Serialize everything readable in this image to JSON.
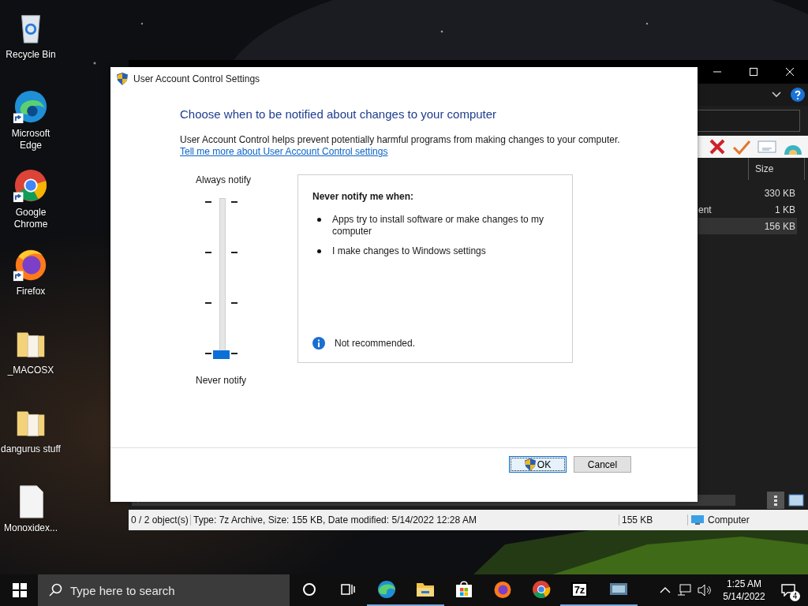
{
  "desktop_icons": [
    {
      "label": "Recycle Bin",
      "kind": "recycle",
      "shortcut": false
    },
    {
      "label": "Microsoft Edge",
      "kind": "edge",
      "shortcut": true
    },
    {
      "label": "Google Chrome",
      "kind": "chrome",
      "shortcut": true
    },
    {
      "label": "Firefox",
      "kind": "firefox",
      "shortcut": true
    },
    {
      "label": "_MACOSX",
      "kind": "folder",
      "shortcut": false
    },
    {
      "label": "dangurus stuff",
      "kind": "folder",
      "shortcut": false
    },
    {
      "label": "Monoxidex...",
      "kind": "file",
      "shortcut": false
    }
  ],
  "file_manager": {
    "columns": [
      "Size"
    ],
    "rows": [
      {
        "name": "",
        "size": "330 KB",
        "selected": false
      },
      {
        "name": "ent",
        "size": "1 KB",
        "selected": false
      },
      {
        "name": "",
        "size": "156 KB",
        "selected": true
      }
    ],
    "status_bar": {
      "objects": "0 / 2 object(s)",
      "details": "Type: 7z Archive, Size: 155 KB, Date modified: 5/14/2022 12:28 AM",
      "size": "155 KB",
      "location": "Computer"
    }
  },
  "dialog": {
    "title": "User Account Control Settings",
    "heading": "Choose when to be notified about changes to your computer",
    "description": "User Account Control helps prevent potentially harmful programs from making changes to your computer.",
    "link": "Tell me more about User Account Control settings",
    "slider": {
      "top_label": "Always notify",
      "bottom_label": "Never notify",
      "level": 0
    },
    "info": {
      "title": "Never notify me when:",
      "bullets": [
        "Apps try to install software or make changes to my computer",
        "I make changes to Windows settings"
      ],
      "note": "Not recommended."
    },
    "buttons": [
      {
        "label": "OK",
        "kind": "shield",
        "focused": true
      },
      {
        "label": "Cancel",
        "kind": "plain",
        "focused": false
      }
    ]
  },
  "taskbar": {
    "search": {
      "placeholder": "Type here to search"
    },
    "apps": [
      {
        "kind": "cortana",
        "running": false
      },
      {
        "kind": "taskview",
        "running": false
      },
      {
        "kind": "edge",
        "running": true
      },
      {
        "kind": "explorer",
        "running": true
      },
      {
        "kind": "store",
        "running": false
      },
      {
        "kind": "firefox",
        "running": false
      },
      {
        "kind": "chrome",
        "running": false
      },
      {
        "kind": "sevenzip",
        "running": true,
        "label": "7z"
      },
      {
        "kind": "monitor",
        "running": true
      }
    ],
    "time": "1:25 AM",
    "date": "5/14/2022",
    "notifications": "4"
  }
}
